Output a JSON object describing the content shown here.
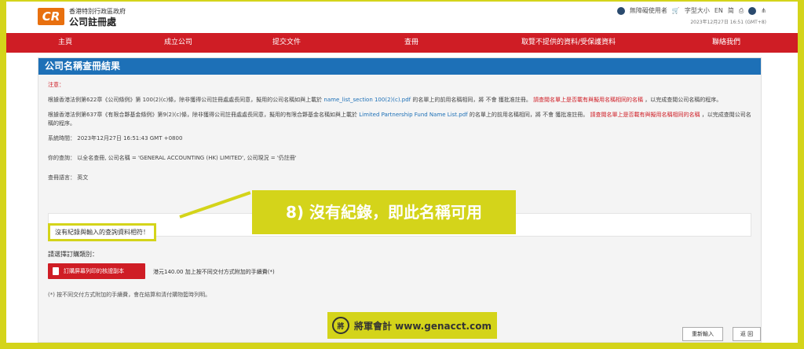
{
  "header": {
    "logo_badge": "CR",
    "logo_line1": "香港特別行政區政府",
    "logo_line2": "公司註冊處",
    "top_right": {
      "accessibility": "無障礙使用者",
      "font_size": "字型大小",
      "lang_en": "EN",
      "lang_sc": "简"
    },
    "timestamp": "2023年12月27日 16:51 (GMT+8)"
  },
  "nav": {
    "items": [
      "主頁",
      "成立公司",
      "提交文件",
      "查冊",
      "取覽不提供的資料/受保護資料",
      "聯絡我們"
    ]
  },
  "panel": {
    "title": "公司名稱查冊結果",
    "note_label": "注意：",
    "para1_a": "根據香港法例第622章《公司條例》第 100(2)(c)條，除非獲得公司註冊處處長同意，擬用的公司名稱如與上載於",
    "para1_link": "name_list_section 100(2)(c).pdf",
    "para1_b": "的名單上的前用名稱相同，將 不會 獲批准註冊。",
    "para1_red": "請查閱名單上是否載有與擬用名稱相同的名稱",
    "para1_c": "，以完成查閱公司名稱的程序。",
    "para2_a": "根據香港法例第637章《有限合夥基金條例》第9(2)(c)條，除非獲得公司註冊處處長同意，擬用的有限合夥基金名稱如與上載於",
    "para2_link": "Limited Partnership Fund Name List.pdf",
    "para2_b": "的名單上的前用名稱相同，將 不會 獲批准註冊。",
    "para2_red": "請查閱名單上是否載有與擬用名稱相同的名稱",
    "para2_c": "，以完成查閱公司名稱的程序。",
    "system_time_label": "系統時間：",
    "system_time_value": "2023年12月27日 16:51:43 GMT +0800",
    "query_label": "你的查詢：",
    "query_value": "以全名查冊, 公司名稱 = 'GENERAL ACCOUNTING (HK) LIMITED', 公司現況 = '仍註冊'",
    "lang_label": "查冊語言：",
    "lang_value": "英文",
    "result_text": "沒有紀錄與輸入的查詢資料相符！",
    "callout": "8) 沒有紀錄，即此名稱可用",
    "order_label": "請選擇訂購類別：",
    "order_button": "訂購屏幕列印的核證副本",
    "fee": "港元140.00 加上按不同交付方式附加的手續費(*)",
    "footnote": "(*) 按不同交付方式附加的手續費，會在結算和清付購物籃時列明。",
    "watermark": "將軍會計 www.genacct.com",
    "watermark_seal": "將",
    "reenter_button": "重新輸入",
    "back_button": "返 回"
  }
}
